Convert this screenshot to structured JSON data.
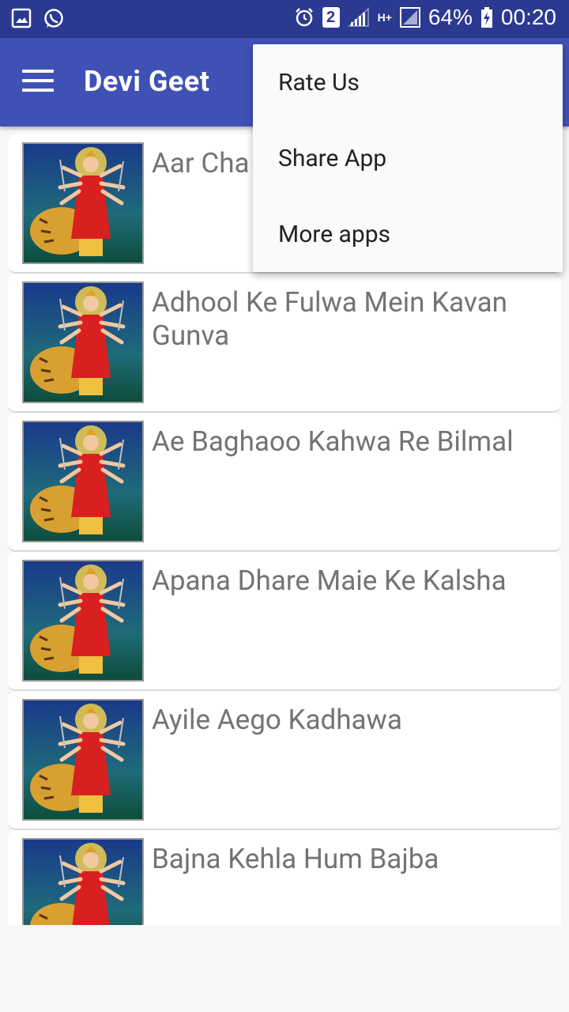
{
  "status_bar": {
    "sim_badge": "2",
    "network_type": "H+",
    "battery_percent": "64%",
    "time": "00:20"
  },
  "app_bar": {
    "title": "Devi Geet"
  },
  "songs": [
    {
      "title": "Aar Cha"
    },
    {
      "title": "Adhool Ke Fulwa Mein Kavan Gunva"
    },
    {
      "title": "Ae Baghaoo Kahwa Re Bilmal"
    },
    {
      "title": "Apana Dhare Maie Ke Kalsha"
    },
    {
      "title": "Ayile Aego Kadhawa"
    },
    {
      "title": "Bajna Kehla Hum Bajba"
    }
  ],
  "overflow_menu": {
    "items": [
      {
        "label": "Rate Us"
      },
      {
        "label": "Share App"
      },
      {
        "label": "More apps"
      }
    ]
  },
  "colors": {
    "status_bar": "#2b3990",
    "app_bar": "#3f51b5",
    "title_text": "#737373"
  }
}
